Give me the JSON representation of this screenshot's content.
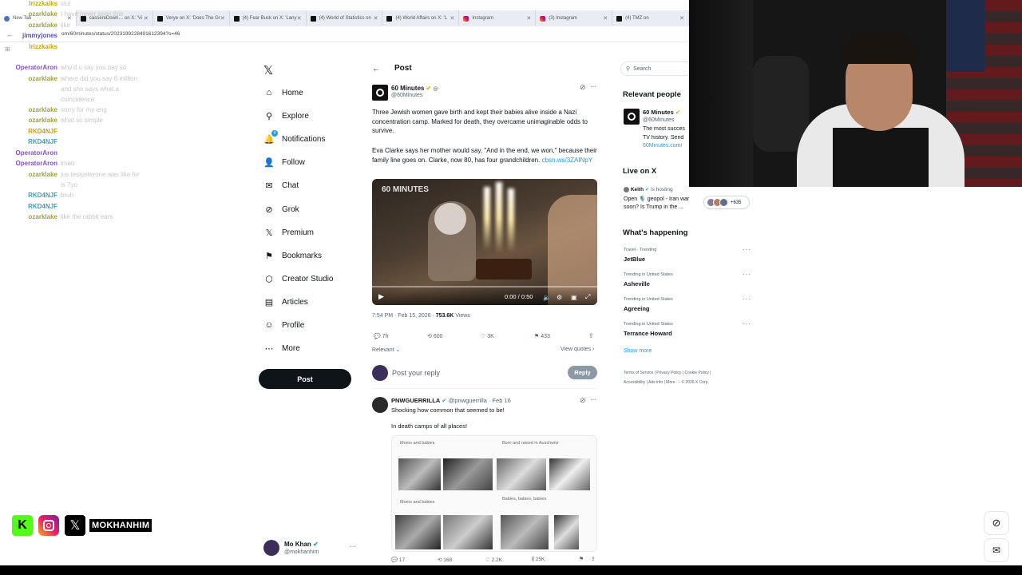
{
  "browser": {
    "tabs": [
      {
        "label": "New Tab",
        "icon": "chrome"
      },
      {
        "label": "cassereDown… on X: 'Vi",
        "icon": "x"
      },
      {
        "label": "Verye on X: 'Does The Gr",
        "icon": "x"
      },
      {
        "label": "(4) Fear Buck on X: 'Lany",
        "icon": "x"
      },
      {
        "label": "(4) World of Statistics on",
        "icon": "x"
      },
      {
        "label": "(4) World Affairs on X: 'L",
        "icon": "x"
      },
      {
        "label": "Instagram",
        "icon": "instagram"
      },
      {
        "label": "(3) Instagram",
        "icon": "instagram"
      },
      {
        "label": "(4) TMZ on",
        "icon": "x"
      }
    ],
    "url": "om/60minutes/status/2023199228491612394?s=46"
  },
  "chat": [
    {
      "user": "lrizzkaiks",
      "text": "slut",
      "color": "#c8a800"
    },
    {
      "user": "ozarklake",
      "text": "I have never seen this",
      "color": "#a0a040"
    },
    {
      "user": "ozarklake",
      "text": "like",
      "color": "#a0a040"
    },
    {
      "user": "jimmyjones",
      "text": "",
      "color": "#5050c0"
    },
    {
      "user": "lrizzkaiks",
      "text": "",
      "color": "#c8a800"
    },
    {
      "user": "OperatorAron",
      "text": "why'd u say you pay so",
      "color": "#8a4fd0"
    },
    {
      "user": "ozarklake",
      "text": "where did you say 6 million",
      "color": "#a0a040"
    },
    {
      "user": "",
      "text": "and she says what a",
      "color": "#a0a040"
    },
    {
      "user": "",
      "text": "coincidence",
      "color": "#a0a040"
    },
    {
      "user": "ozarklake",
      "text": "sorry for my eng",
      "color": "#a0a040"
    },
    {
      "user": "ozarklake",
      "text": "what so simple",
      "color": "#a0a040"
    },
    {
      "user": "RKD4NJF",
      "text": "",
      "color": "#d0a000"
    },
    {
      "user": "RKD4NJF",
      "text": "",
      "color": "#40a0c0"
    },
    {
      "user": "OperatorAron",
      "text": "",
      "color": "#8a4fd0"
    },
    {
      "user": "OperatorAron",
      "text": "lmao",
      "color": "#8a4fd0"
    },
    {
      "user": "ozarklake",
      "text": "jus testosterone was like for",
      "color": "#a0a040"
    },
    {
      "user": "",
      "text": "is 7yo",
      "color": "#a0a040"
    },
    {
      "user": "RKD4NJF",
      "text": "bruh",
      "color": "#40a0c0"
    },
    {
      "user": "RKD4NJF",
      "text": "",
      "color": "#40a0c0"
    },
    {
      "user": "ozarklake",
      "text": "like the rabbit ears",
      "color": "#a0a040"
    }
  ],
  "socials": {
    "handle": "MOKHANHIM"
  },
  "nav": [
    {
      "label": "Home",
      "icon": "home-icon"
    },
    {
      "label": "Explore",
      "icon": "search-icon"
    },
    {
      "label": "Notifications",
      "icon": "bell-icon",
      "badge": "4"
    },
    {
      "label": "Follow",
      "icon": "follow-icon"
    },
    {
      "label": "Chat",
      "icon": "mail-icon"
    },
    {
      "label": "Grok",
      "icon": "grok-icon"
    },
    {
      "label": "Premium",
      "icon": "x-icon"
    },
    {
      "label": "Bookmarks",
      "icon": "bookmark-icon"
    },
    {
      "label": "Creator Studio",
      "icon": "studio-icon"
    },
    {
      "label": "Articles",
      "icon": "articles-icon"
    },
    {
      "label": "Profile",
      "icon": "profile-icon"
    },
    {
      "label": "More",
      "icon": "more-icon"
    }
  ],
  "post_button": "Post",
  "account": {
    "name": "Mo Khan",
    "handle": "@mokhanhim"
  },
  "header": {
    "title": "Post"
  },
  "tweet": {
    "author": "60 Minutes",
    "handle": "@60Minutes",
    "text1": "Three Jewish women gave birth and kept their babies alive inside a Nazi concentration camp. Marked for death, they overcame unimaginable odds to survive.",
    "text2": "Eva Clarke says her mother would say, \"And in the end, we won,\" because their family line goes on. Clarke, now 80, has four grandchildren.",
    "link": "cbsn.ws/3ZAINpY",
    "video_logo": "60 MINUTES",
    "video_time": "0:00 / 0:50",
    "meta_time": "7:54 PM · Feb 15, 2026 ·",
    "views": "753.6K",
    "views_label": "Views",
    "replies": "7h",
    "reposts": "600",
    "likes": "3K",
    "bookmarks": "433",
    "sort": "Relevant",
    "view_quotes": "View quotes"
  },
  "reply_box": {
    "placeholder": "Post your reply",
    "button": "Reply"
  },
  "reply": {
    "author": "PNWGUERRILLA",
    "handle": "@pnwguerrilla",
    "date": "· Feb 16",
    "text1": "Shocking how common that seemed to be!",
    "text2": "In death camps of all places!",
    "img_title1": "Moms and babies",
    "img_title2": "Born and raised in Auschwitz",
    "img_title3": "Moms and babies",
    "img_title4": "Babies, babies, babies",
    "replies": "17",
    "reposts": "168",
    "likes": "2.2K",
    "views": "25K"
  },
  "sidebar": {
    "search_placeholder": "Search",
    "relevant_title": "Relevant people",
    "person_name": "60 Minutes",
    "person_handle": "@60Minutes",
    "person_bio1": "The most succes",
    "person_bio2": "TV history. Send",
    "person_bio3": "60Minutes.com/",
    "live_title": "Live on X",
    "live_host": "Keith",
    "live_status": "is hosting",
    "live_text1": "Open 🎙️ geopol - Iran war",
    "live_text2": "soon? Is Trump in the ...",
    "live_count": "+635",
    "happening_title": "What's happening",
    "trends": [
      {
        "context": "Travel · Trending",
        "name": "JetBlue"
      },
      {
        "context": "Trending in United States",
        "name": "Asheville"
      },
      {
        "context": "Trending in United States",
        "name": "Agreeing"
      },
      {
        "context": "Trending in United States",
        "name": "Terrance Howard"
      }
    ],
    "show_more": "Show more",
    "footer1": "Terms of Service  |  Privacy Policy  |  Cookie Policy  |",
    "footer2": "Accessibility  |  Ads info  |  More ···  © 2026 X Corp."
  }
}
